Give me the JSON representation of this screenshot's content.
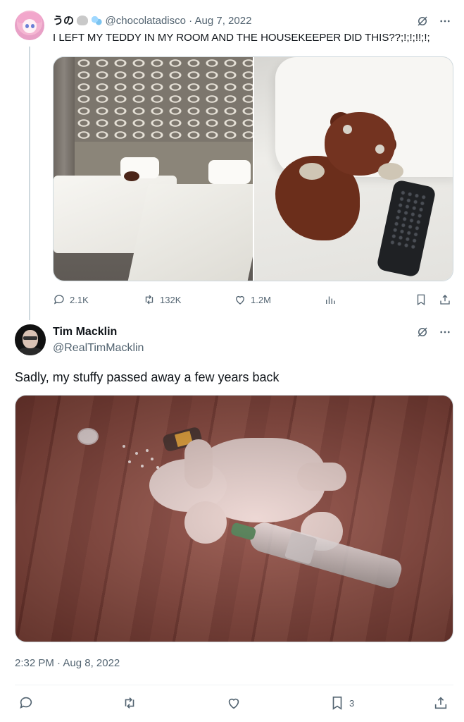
{
  "tweet1": {
    "name": "うの",
    "handle": "@chocolatadisco",
    "separator": "·",
    "date": "Aug 7, 2022",
    "text": "I LEFT MY TEDDY IN MY ROOM AND THE HOUSEKEEPER DID THIS??;!;!;!!;!;",
    "stats": {
      "replies": "2.1K",
      "retweets": "132K",
      "likes": "1.2M"
    },
    "emoji": [
      "mouse-emoji",
      "bubbles-emoji"
    ]
  },
  "tweet2": {
    "name": "Tim Macklin",
    "handle": "@RealTimMacklin",
    "text": "Sadly, my stuffy passed away a few years back",
    "timestamp": "2:32 PM · Aug 8, 2022",
    "stats": {
      "bookmarks": "3"
    }
  },
  "colors": {
    "text": "#0f1419",
    "muted": "#536471",
    "border": "#cfd9de",
    "divider": "#eff3f4"
  },
  "icons": [
    "grok-icon",
    "more-icon",
    "reply-icon",
    "retweet-icon",
    "like-icon",
    "views-icon",
    "bookmark-icon",
    "share-icon"
  ]
}
